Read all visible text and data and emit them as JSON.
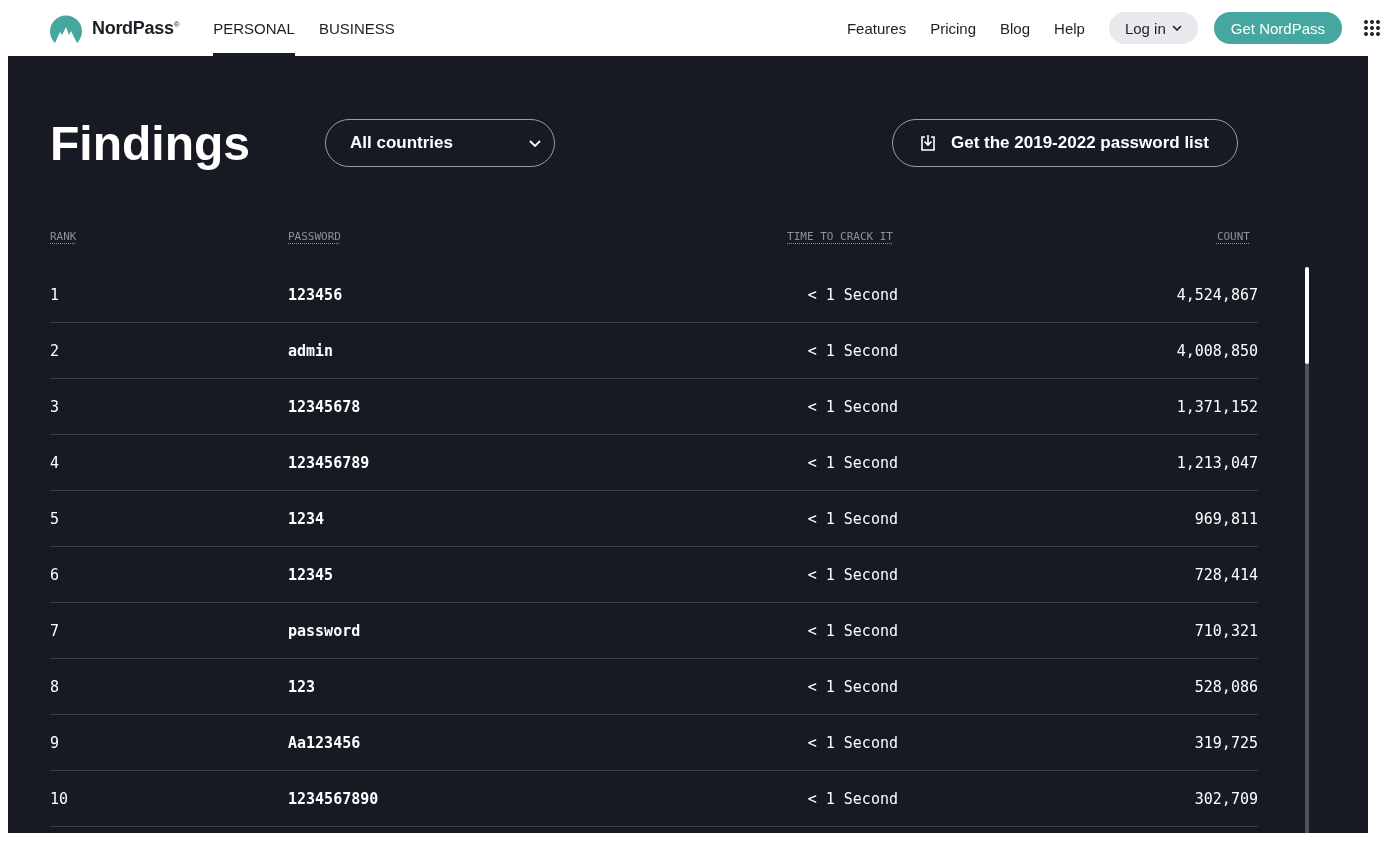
{
  "header": {
    "logo": "NordPass$^{®}$",
    "tabs": [
      {
        "label": "PERSONAL",
        "selected": true
      },
      {
        "label": "BUSINESS",
        "selected": false
      }
    ],
    "nav_links": [
      "Features",
      "Pricing",
      "Blog",
      "Help"
    ],
    "login_button": {
      "label": "Log in"
    },
    "cta_button": {
      "label": "Get NordPass"
    }
  },
  "findings": {
    "title": "Findings",
    "country_select": {
      "value": "All countries"
    },
    "download_button": {
      "label": "Get the 2019-2022 password list"
    },
    "table": {
      "columns": [
        "RANK",
        "PASSWORD",
        "TIME TO CRACK IT",
        "COUNT"
      ],
      "rows": [
        {
          "rank": "1",
          "password": "123456",
          "time": "< 1 Second",
          "count": "4,524,867"
        },
        {
          "rank": "2",
          "password": "admin",
          "time": "< 1 Second",
          "count": "4,008,850"
        },
        {
          "rank": "3",
          "password": "12345678",
          "time": "< 1 Second",
          "count": "1,371,152"
        },
        {
          "rank": "4",
          "password": "123456789",
          "time": "< 1 Second",
          "count": "1,213,047"
        },
        {
          "rank": "5",
          "password": "1234",
          "time": "< 1 Second",
          "count": "969,811"
        },
        {
          "rank": "6",
          "password": "12345",
          "time": "< 1 Second",
          "count": "728,414"
        },
        {
          "rank": "7",
          "password": "password",
          "time": "< 1 Second",
          "count": "710,321"
        },
        {
          "rank": "8",
          "password": "123",
          "time": "< 1 Second",
          "count": "528,086"
        },
        {
          "rank": "9",
          "password": "Aa123456",
          "time": "< 1 Second",
          "count": "319,725"
        },
        {
          "rank": "10",
          "password": "1234567890",
          "time": "< 1 Second",
          "count": "302,709"
        }
      ]
    }
  }
}
